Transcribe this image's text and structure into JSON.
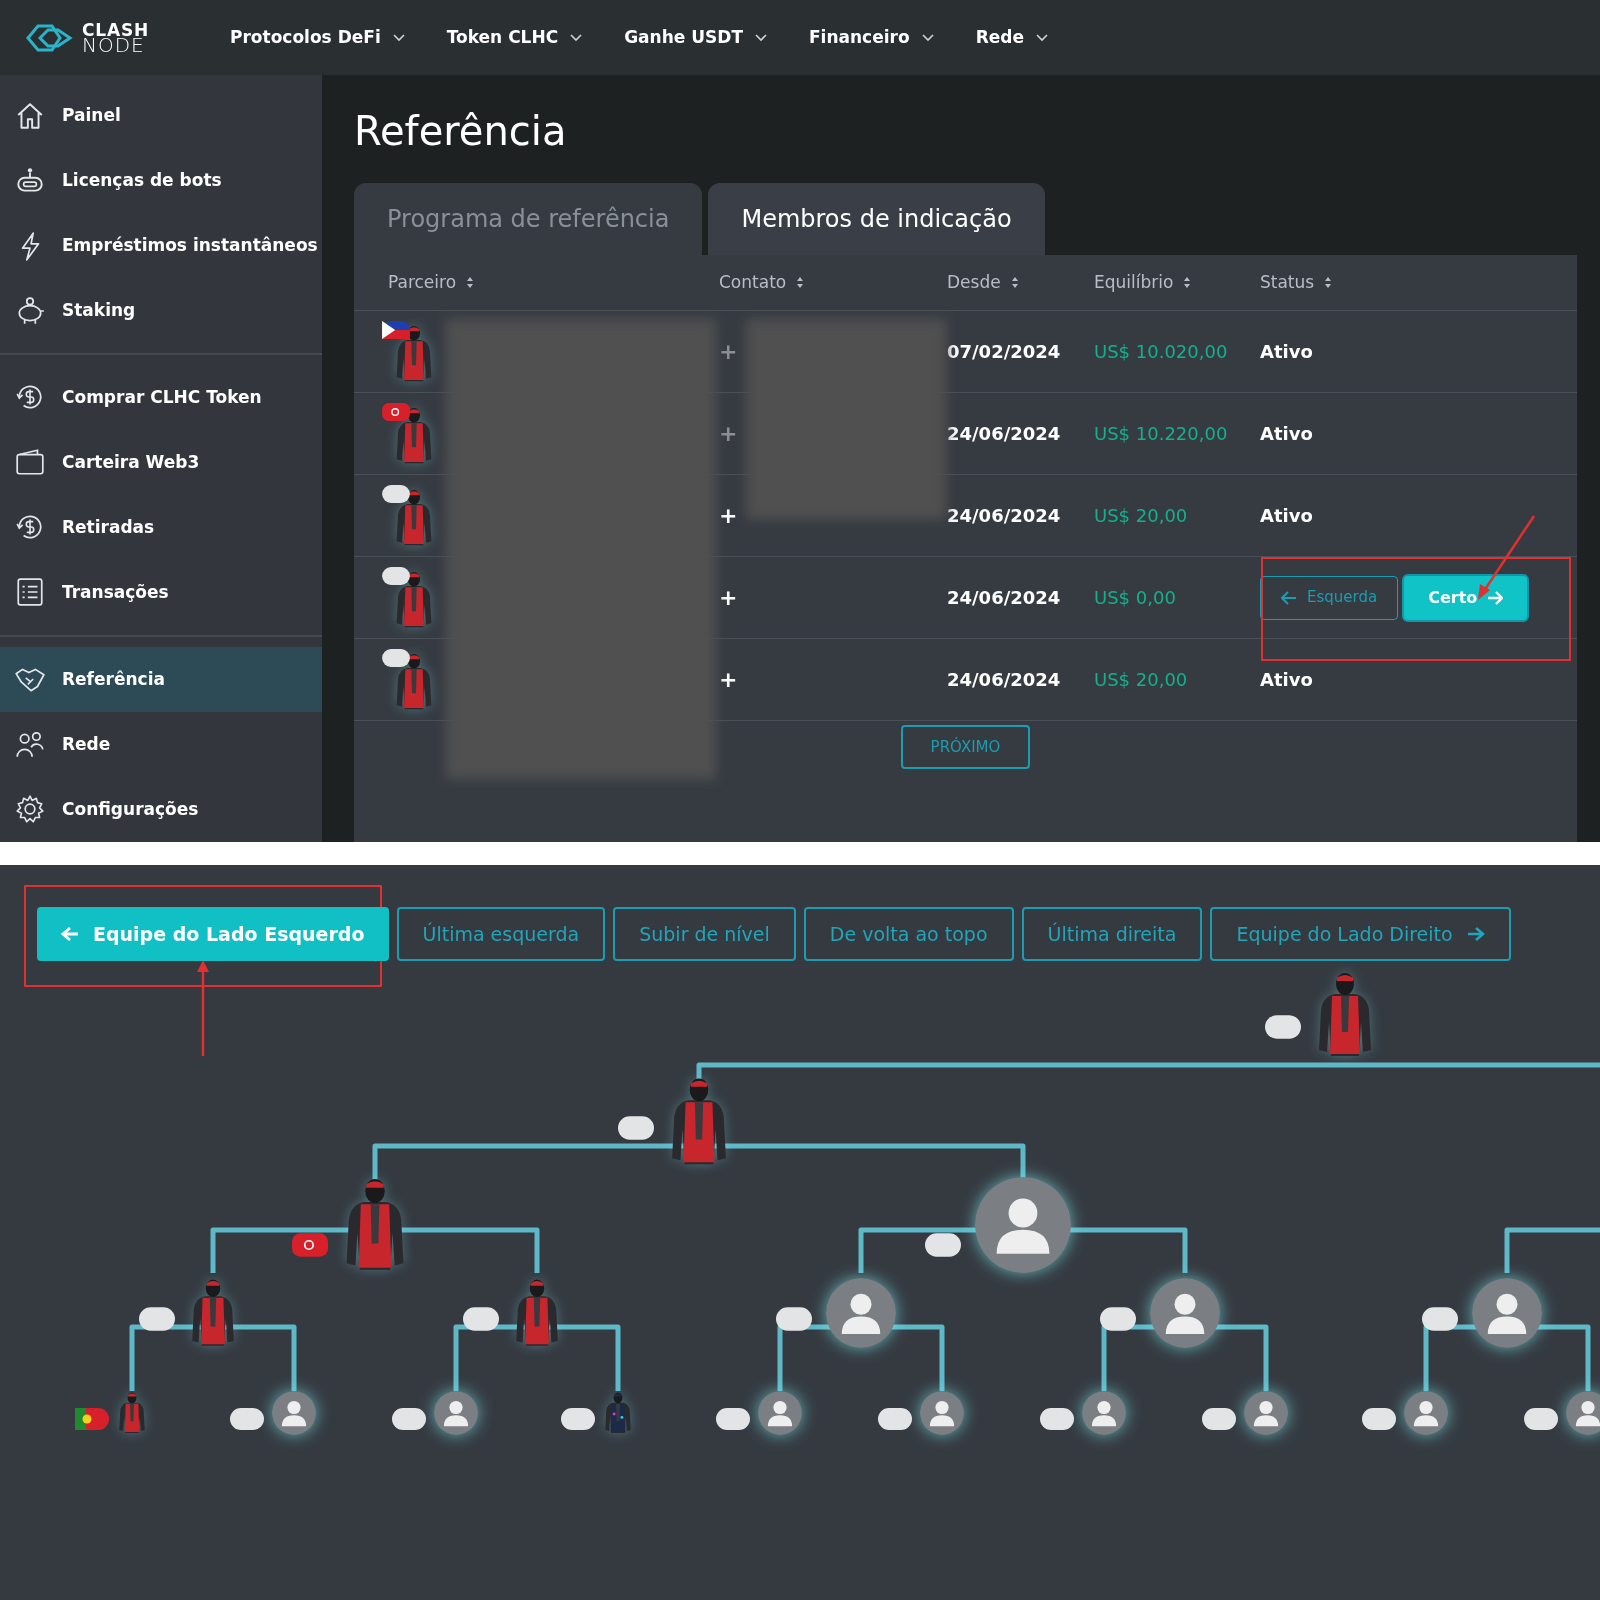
{
  "logo": {
    "line_1": "CLASH",
    "line_2": "NODE"
  },
  "nav": [
    "Protocolos DeFi",
    "Token CLHC",
    "Ganhe USDT",
    "Financeiro",
    "Rede"
  ],
  "sidebar": [
    {
      "label": "Painel",
      "selected": false,
      "divider_after": false
    },
    {
      "label": "Licenças de bots",
      "selected": false,
      "divider_after": false
    },
    {
      "label": "Empréstimos instantâneos",
      "selected": false,
      "divider_after": false
    },
    {
      "label": "Staking",
      "selected": false,
      "divider_after": true
    },
    {
      "label": "Comprar CLHC Token",
      "selected": false,
      "divider_after": false
    },
    {
      "label": "Carteira Web3",
      "selected": false,
      "divider_after": false
    },
    {
      "label": "Retiradas",
      "selected": false,
      "divider_after": false
    },
    {
      "label": "Transações",
      "selected": false,
      "divider_after": true
    },
    {
      "label": "Referência",
      "selected": true,
      "divider_after": false
    },
    {
      "label": "Rede",
      "selected": false,
      "divider_after": false
    },
    {
      "label": "Configurações",
      "selected": false,
      "divider_after": false
    }
  ],
  "page_title": "Referência",
  "tabs": [
    {
      "label": "Programa de referência",
      "selected": false
    },
    {
      "label": "Membros de indicação",
      "selected": true
    }
  ],
  "table": {
    "columns": [
      "Parceiro",
      "Contato",
      "Desde",
      "Equilíbrio",
      "Status"
    ],
    "rows": [
      {
        "flag": {
          "kind": "ph"
        },
        "contact": "+",
        "contact_obscured": true,
        "since": "07/02/2024",
        "balance": "US$ 10.020,00",
        "kind": "status",
        "status": "Ativo"
      },
      {
        "flag": {
          "kind": "tr"
        },
        "contact": "+",
        "contact_obscured": true,
        "since": "24/06/2024",
        "balance": "US$ 10.220,00",
        "kind": "status",
        "status": "Ativo"
      },
      {
        "flag": {
          "kind": "blank"
        },
        "contact": "+",
        "contact_obscured": false,
        "since": "24/06/2024",
        "balance": "US$ 20,00",
        "kind": "status",
        "status": "Ativo"
      },
      {
        "flag": {
          "kind": "blank"
        },
        "contact": "+",
        "contact_obscured": false,
        "since": "24/06/2024",
        "balance": "US$ 0,00",
        "kind": "placement",
        "left_button": "Esquerda",
        "right_button": "Certo"
      },
      {
        "flag": {
          "kind": "blank"
        },
        "contact": "+",
        "contact_obscured": false,
        "since": "24/06/2024",
        "balance": "US$ 20,00",
        "kind": "status",
        "status": "Ativo"
      }
    ],
    "next_button": "PRÓXIMO"
  },
  "tree_buttons": [
    {
      "label": "Equipe do Lado Esquerdo",
      "kind": "filled_left_arrow"
    },
    {
      "label": "Última esquerda",
      "kind": "outline"
    },
    {
      "label": "Subir de nível",
      "kind": "outline"
    },
    {
      "label": "De volta ao topo",
      "kind": "outline"
    },
    {
      "label": "Última direita",
      "kind": "outline"
    },
    {
      "label": "Equipe do Lado Direito",
      "kind": "outline_right_arrow"
    }
  ],
  "tree": {
    "root": {
      "kind": "member",
      "flag": {
        "kind": "blank"
      },
      "children": [
        {
          "kind": "member",
          "flag": {
            "kind": "blank"
          },
          "children": [
            {
              "kind": "member",
              "flag": {
                "kind": "tr"
              },
              "children": [
                {
                  "kind": "member",
                  "flag": {
                    "kind": "blank"
                  },
                  "children": [
                    {
                      "kind": "member",
                      "flag": {
                        "kind": "pt"
                      }
                    },
                    {
                      "kind": "empty",
                      "flag": {
                        "kind": "blank"
                      }
                    }
                  ]
                },
                {
                  "kind": "member",
                  "flag": {
                    "kind": "blank"
                  },
                  "children": [
                    {
                      "kind": "empty",
                      "flag": {
                        "kind": "blank"
                      }
                    },
                    {
                      "kind": "member_dark",
                      "flag": {
                        "kind": "blank"
                      }
                    }
                  ]
                }
              ]
            },
            {
              "kind": "empty",
              "flag": {
                "kind": "blank"
              },
              "children": [
                {
                  "kind": "empty",
                  "flag": {
                    "kind": "blank"
                  },
                  "children": [
                    {
                      "kind": "empty",
                      "flag": {
                        "kind": "blank"
                      }
                    },
                    {
                      "kind": "empty",
                      "flag": {
                        "kind": "blank"
                      }
                    }
                  ]
                },
                {
                  "kind": "empty",
                  "flag": {
                    "kind": "blank"
                  },
                  "children": [
                    {
                      "kind": "empty",
                      "flag": {
                        "kind": "blank"
                      }
                    },
                    {
                      "kind": "empty",
                      "flag": {
                        "kind": "blank"
                      }
                    }
                  ]
                }
              ]
            }
          ]
        }
      ]
    },
    "right_edge_node": {
      "kind": "empty",
      "flag": {
        "kind": "blank"
      },
      "children": [
        {
          "kind": "empty",
          "flag": {
            "kind": "blank"
          }
        },
        {
          "kind": "empty",
          "flag": {
            "kind": "blank"
          }
        }
      ]
    }
  }
}
